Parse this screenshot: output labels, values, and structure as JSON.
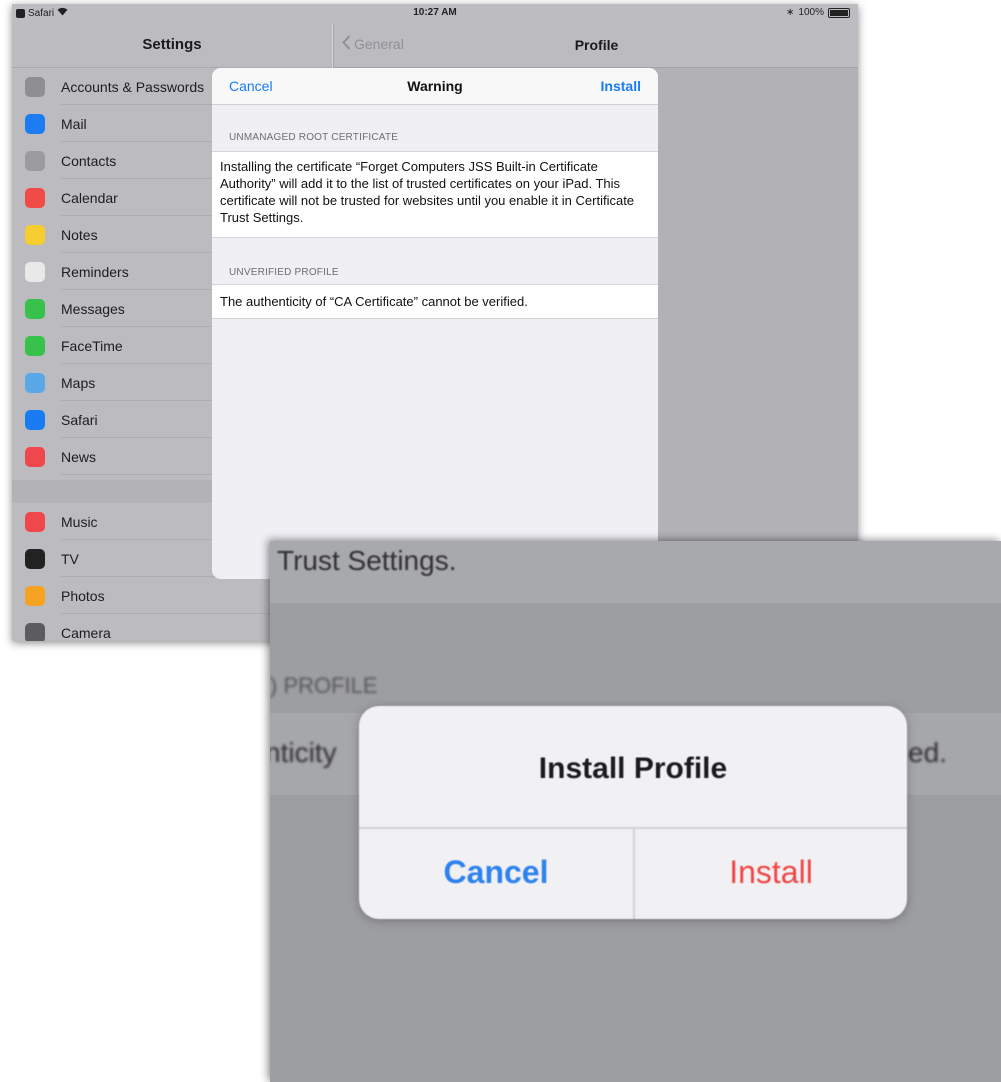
{
  "status_bar": {
    "app": "Safari",
    "time": "10:27 AM",
    "battery": "100%"
  },
  "settings": {
    "title": "Settings",
    "items": [
      {
        "label": "Accounts & Passwords",
        "icon": "key-icon",
        "color": "#8e8e93"
      },
      {
        "label": "Mail",
        "icon": "mail-icon",
        "color": "#1e7cf2"
      },
      {
        "label": "Contacts",
        "icon": "contacts-icon",
        "color": "#9b9b9f"
      },
      {
        "label": "Calendar",
        "icon": "calendar-icon",
        "color": "#f14b47"
      },
      {
        "label": "Notes",
        "icon": "notes-icon",
        "color": "#f6cc2f"
      },
      {
        "label": "Reminders",
        "icon": "reminders-icon",
        "color": "#e9e9ea"
      },
      {
        "label": "Messages",
        "icon": "messages-icon",
        "color": "#37c24b"
      },
      {
        "label": "FaceTime",
        "icon": "facetime-icon",
        "color": "#37c24b"
      },
      {
        "label": "Maps",
        "icon": "maps-icon",
        "color": "#5aa8e8"
      },
      {
        "label": "Safari",
        "icon": "safari-icon",
        "color": "#1a7cf5"
      },
      {
        "label": "News",
        "icon": "news-icon",
        "color": "#f0474d"
      }
    ],
    "items2": [
      {
        "label": "Music",
        "icon": "music-icon",
        "color": "#f0474d"
      },
      {
        "label": "TV",
        "icon": "tv-icon",
        "color": "#222222"
      },
      {
        "label": "Photos",
        "icon": "photos-icon",
        "color": "#f6a323"
      },
      {
        "label": "Camera",
        "icon": "camera-icon",
        "color": "#5c5c60"
      }
    ]
  },
  "detail": {
    "back_label": "General",
    "title": "Profile"
  },
  "modal": {
    "cancel_label": "Cancel",
    "title": "Warning",
    "install_label": "Install",
    "section1_header": "UNMANAGED ROOT CERTIFICATE",
    "section1_text": "Installing the certificate “Forget Computers JSS Built-in Certificate Authority” will add it to the list of trusted certificates on your iPad. This certificate will not be trusted for websites until you enable it in Certificate Trust Settings.",
    "section2_header": "UNVERIFIED PROFILE",
    "section2_text": "The authenticity of “CA Certificate” cannot be verified."
  },
  "zoom": {
    "trust_text": "Trust Settings.",
    "section_label": ") PROFILE",
    "row_left": "nticity",
    "row_right": "ed.",
    "alert_title": "Install Profile",
    "alert_cancel": "Cancel",
    "alert_install": "Install"
  },
  "colors": {
    "accent": "#1a7cf5",
    "destructive": "#f04545"
  }
}
